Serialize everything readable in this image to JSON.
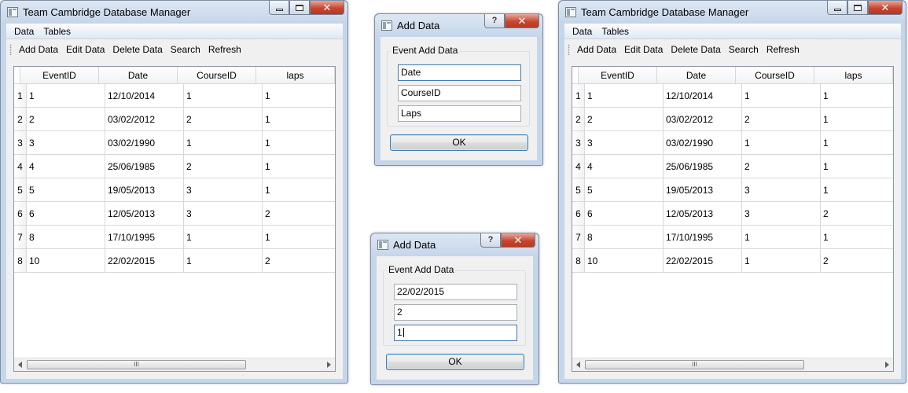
{
  "main_window": {
    "title": "Team Cambridge Database Manager",
    "menu": [
      "Data",
      "Tables"
    ],
    "toolbar": [
      "Add Data",
      "Edit Data",
      "Delete Data",
      "Search",
      "Refresh"
    ],
    "table": {
      "columns": [
        "EventID",
        "Date",
        "CourseID",
        "laps"
      ],
      "rows": [
        {
          "n": "1",
          "cells": [
            "1",
            "12/10/2014",
            "1",
            "1"
          ]
        },
        {
          "n": "2",
          "cells": [
            "2",
            "03/02/2012",
            "2",
            "1"
          ]
        },
        {
          "n": "3",
          "cells": [
            "3",
            "03/02/1990",
            "1",
            "1"
          ]
        },
        {
          "n": "4",
          "cells": [
            "4",
            "25/06/1985",
            "2",
            "1"
          ]
        },
        {
          "n": "5",
          "cells": [
            "5",
            "19/05/2013",
            "3",
            "1"
          ]
        },
        {
          "n": "6",
          "cells": [
            "6",
            "12/05/2013",
            "3",
            "2"
          ]
        },
        {
          "n": "7",
          "cells": [
            "8",
            "17/10/1995",
            "1",
            "1"
          ]
        },
        {
          "n": "8",
          "cells": [
            "10",
            "22/02/2015",
            "1",
            "2"
          ]
        }
      ],
      "scroll_thumb": "III"
    }
  },
  "dialog_empty": {
    "title": "Add Data",
    "help": "?",
    "group_title": "Event Add Data",
    "fields": [
      {
        "placeholder": "Date",
        "value": ""
      },
      {
        "placeholder": "CourseID",
        "value": ""
      },
      {
        "placeholder": "Laps",
        "value": ""
      }
    ],
    "ok": "OK"
  },
  "dialog_filled": {
    "title": "Add Data",
    "help": "?",
    "group_title": "Event Add Data",
    "fields": [
      {
        "placeholder": "",
        "value": "22/02/2015"
      },
      {
        "placeholder": "",
        "value": "2"
      },
      {
        "placeholder": "",
        "value": "1"
      }
    ],
    "ok": "OK"
  },
  "colors": {
    "frame": "#c5d5ea",
    "close_button": "#c7462f",
    "focus_border": "#3d7bad"
  },
  "icons": [
    "app-window-icon",
    "minimize-icon",
    "maximize-icon",
    "close-icon",
    "help-icon",
    "scroll-left-icon",
    "scroll-right-icon"
  ]
}
